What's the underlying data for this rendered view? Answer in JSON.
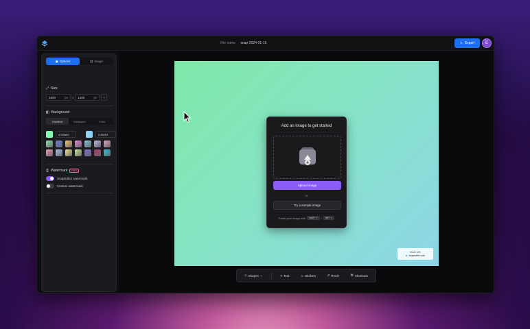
{
  "topbar": {
    "filename_label": "File name",
    "filename_value": "snap-2024-01-15",
    "export_label": "Export",
    "avatar_initial": "E"
  },
  "sidebar": {
    "tabs": [
      {
        "label": "Options"
      },
      {
        "label": "Image"
      }
    ],
    "size": {
      "title": "Size",
      "width": "1500",
      "height": "1400",
      "unit": "px",
      "times": "x"
    },
    "background": {
      "title": "Background",
      "tabs": [
        {
          "label": "Gradient"
        },
        {
          "label": "Wallpaper"
        },
        {
          "label": "Color"
        }
      ],
      "color1_hex": "# 84fab0",
      "color2_hex": "# 8fd3f4",
      "color1": "#84fab0",
      "color2": "#8fd3f4",
      "swatches": [
        "#8ee6b0",
        "#6a7be0",
        "#f6c36a",
        "#e57fd8",
        "#7fc7e0",
        "#b9b2e8",
        "#e6a2c2",
        "#f29ab0",
        "#a6c6f2",
        "#f2e48a",
        "#c6ef8a",
        "#7a6ad8",
        "#b0336e",
        "#28c6d8"
      ]
    },
    "watermark": {
      "title": "Watermark",
      "badge": "PRO",
      "option1": "SnapEditor watermark",
      "option2": "Custom watermark"
    }
  },
  "canvas": {
    "watermark_line1": "Made with",
    "watermark_line2": "snapeditor.com"
  },
  "upload_card": {
    "title": "Add an image to get started",
    "upload_label": "Upload image",
    "or_label": "or",
    "sample_label": "Try a sample image",
    "paste_prefix": "Paste your image with",
    "kbd1": "cmd + v",
    "sep": "/",
    "kbd2": "ctrl + v"
  },
  "toolbar": {
    "items": [
      {
        "label": "Shapes"
      },
      {
        "label": "Text"
      },
      {
        "label": "Stickers"
      },
      {
        "label": "Reset"
      },
      {
        "label": "Shortcuts"
      }
    ]
  }
}
